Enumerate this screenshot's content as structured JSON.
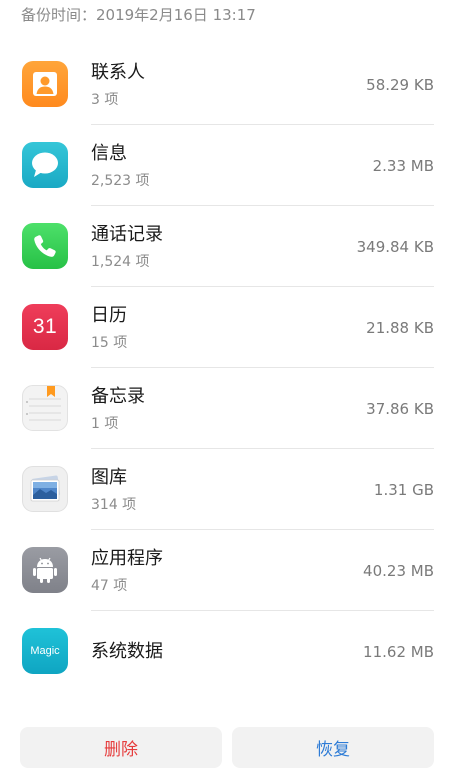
{
  "backup_time": "备份时间：2019年2月16日 13:17",
  "items": [
    {
      "name": "联系人",
      "count": "3 项",
      "size": "58.29 KB",
      "icon": "contacts-icon"
    },
    {
      "name": "信息",
      "count": "2,523 项",
      "size": "2.33 MB",
      "icon": "messages-icon"
    },
    {
      "name": "通话记录",
      "count": "1,524 项",
      "size": "349.84 KB",
      "icon": "phone-icon"
    },
    {
      "name": "日历",
      "count": "15 项",
      "size": "21.88 KB",
      "icon": "calendar-icon",
      "icon_text": "31"
    },
    {
      "name": "备忘录",
      "count": "1 项",
      "size": "37.86 KB",
      "icon": "memo-icon"
    },
    {
      "name": "图库",
      "count": "314 项",
      "size": "1.31 GB",
      "icon": "gallery-icon"
    },
    {
      "name": "应用程序",
      "count": "47 项",
      "size": "40.23 MB",
      "icon": "android-icon"
    },
    {
      "name": "系统数据",
      "size": "11.62 MB",
      "icon": "magic-icon",
      "icon_text": "Magic"
    }
  ],
  "actions": {
    "delete_label": "删除",
    "restore_label": "恢复"
  },
  "colors": {
    "delete": "#e63b3b",
    "restore": "#2e7cd6"
  }
}
